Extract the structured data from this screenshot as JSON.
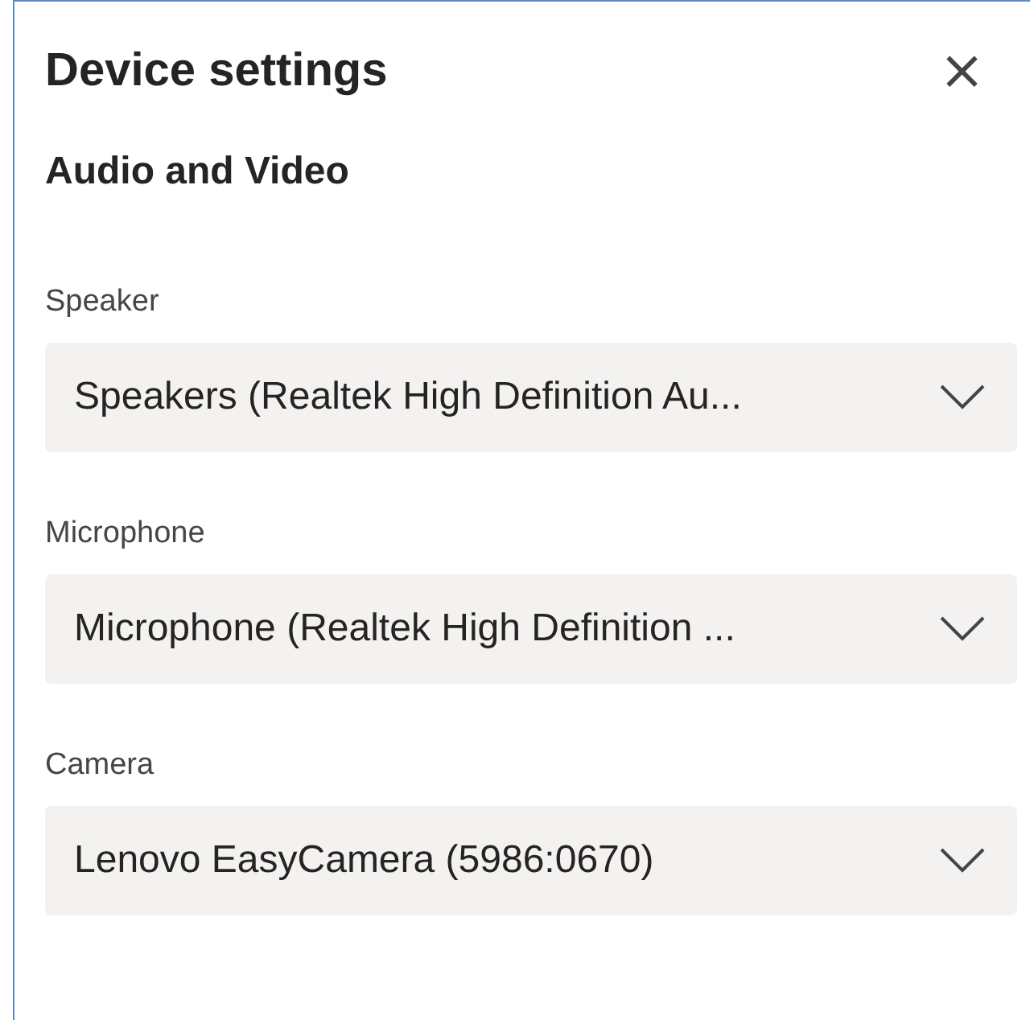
{
  "dialog": {
    "title": "Device settings",
    "close": "×"
  },
  "section": {
    "title": "Audio and Video"
  },
  "devices": [
    {
      "label": "Speaker",
      "value": "Speakers (Realtek High Definition Au..."
    },
    {
      "label": "Microphone",
      "value": "Microphone (Realtek High Definition ..."
    },
    {
      "label": "Camera",
      "value": "Lenovo EasyCamera (5986:0670)"
    }
  ]
}
